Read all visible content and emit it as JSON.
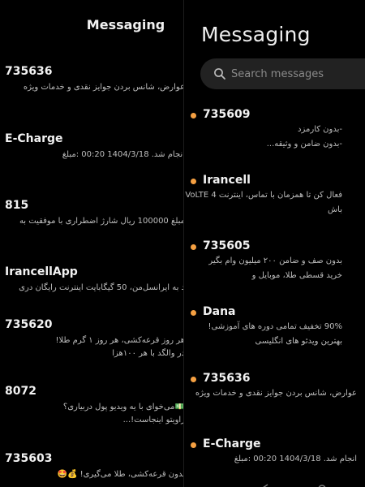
{
  "left_pane": {
    "title": "Messaging",
    "items": [
      {
        "sender": "735636",
        "snippet": "عوارض، شانس بردن جوایز نقدی و خدمات ویژه"
      },
      {
        "sender": "E-Charge",
        "snippet": "انجام شد. 1404/3/18 00:20 :مبلغ"
      },
      {
        "sender": "815",
        "snippet": "مبلغ 100000 ریال شارژ اضطراری با موفقیت به"
      },
      {
        "sender": "IrancellApp",
        "snippet": "د به ایرانسل‌من، 50 گیگابایت اینترنت رایگان دری"
      },
      {
        "sender": "735620",
        "snippet": "هر روز قرعه‌کشی، هر روز ۱ گرم طلا!\nدر والگد با هر ۱۰۰هزا"
      },
      {
        "sender": "8072",
        "snippet": "💵می‌خوای با یه ویدیو پول دربیاری؟\nراویتو اینجاست!..."
      },
      {
        "sender": "735603",
        "snippet": "بدون قرعه‌کشی، طلا می‌گیری! 💰🤩"
      }
    ]
  },
  "right_pane": {
    "title": "Messaging",
    "search": {
      "placeholder": "Search messages"
    },
    "accent_color": "#f5a042",
    "items": [
      {
        "sender": "735609",
        "snippet": "-بدون کارمزد\n-بدون ضامن و وثیقه..."
      },
      {
        "sender": "Irancell",
        "snippet": "فعال کن تا همزمان با تماس، اینترنت 4 VoLTE\nباش"
      },
      {
        "sender": "735605",
        "snippet": "بدون صف و ضامن ۲۰۰ میلیون وام بگیر\nخرید قسطی طلا، موبایل و"
      },
      {
        "sender": "Dana",
        "snippet": "90% تخفیف تمامی دوره های آموزشی!\nبهترین ویدئو های انگلیسی"
      },
      {
        "sender": "735636",
        "snippet": "عوارض، شانس بردن جوایز نقدی و خدمات ویژه"
      },
      {
        "sender": "E-Charge",
        "snippet": "انجام شد. 1404/3/18 00:20 :مبلغ"
      }
    ]
  }
}
